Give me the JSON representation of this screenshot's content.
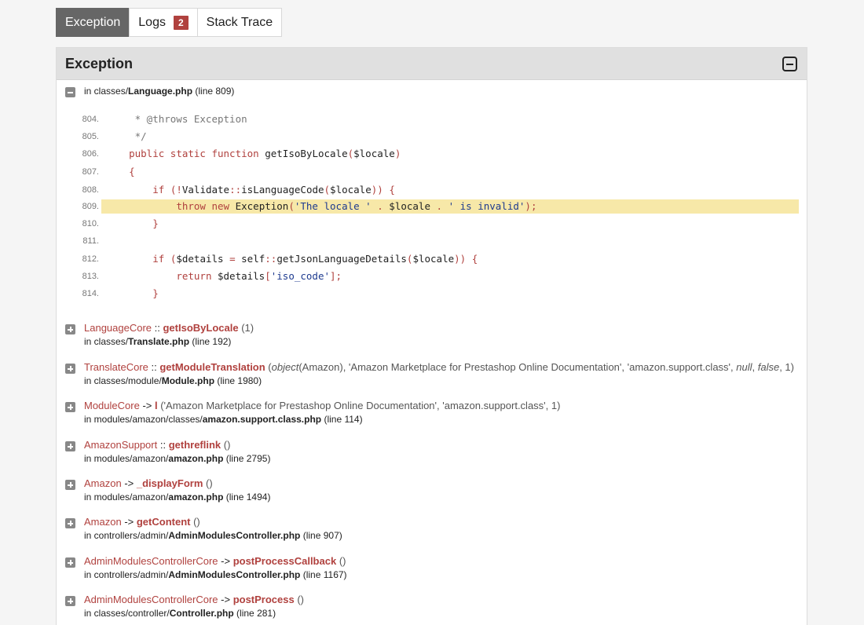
{
  "tabs": [
    {
      "label": "Exception",
      "active": true
    },
    {
      "label": "Logs",
      "badge": "2"
    },
    {
      "label": "Stack Trace"
    }
  ],
  "panel": {
    "title": "Exception",
    "location": {
      "prefix": "in classes/",
      "file": "Language.php",
      "suffix": " (line 809)"
    }
  },
  "code": [
    {
      "num": "804.",
      "text": "     * @throws Exception"
    },
    {
      "num": "805.",
      "text": "     */"
    },
    {
      "num": "806.",
      "text": "    public static function getIsoByLocale($locale)"
    },
    {
      "num": "807.",
      "text": "    {"
    },
    {
      "num": "808.",
      "text": "        if (!Validate::isLanguageCode($locale)) {"
    },
    {
      "num": "809.",
      "text": "            throw new Exception('The locale ' . $locale . ' is invalid');",
      "highlight": true
    },
    {
      "num": "810.",
      "text": "        }"
    },
    {
      "num": "811.",
      "text": ""
    },
    {
      "num": "812.",
      "text": "        if ($details = self::getJsonLanguageDetails($locale)) {"
    },
    {
      "num": "813.",
      "text": "            return $details['iso_code'];"
    },
    {
      "num": "814.",
      "text": "        }"
    }
  ],
  "frames": [
    {
      "cls": "LanguageCore",
      "sep": " :: ",
      "fn": "getIsoByLocale",
      "args": " (1)",
      "loc_prefix": "in classes/",
      "loc_file": "Translate.php",
      "loc_suffix": " (line 192)"
    },
    {
      "cls": "TranslateCore",
      "sep": " :: ",
      "fn": "getModuleTranslation",
      "args_pre": " (",
      "args_obj": "object",
      "args_mid": "(Amazon), 'Amazon Marketplace for Prestashop Online Documentation', 'amazon.support.class', ",
      "args_null": "null",
      "args_sep": ", ",
      "args_false": "false",
      "args_end": ", 1)",
      "loc_prefix": "in classes/module/",
      "loc_file": "Module.php",
      "loc_suffix": " (line 1980)"
    },
    {
      "cls": "ModuleCore",
      "sep": " -> ",
      "fn": "l",
      "args": " ('Amazon Marketplace for Prestashop Online Documentation', 'amazon.support.class', 1)",
      "loc_prefix": "in modules/amazon/classes/",
      "loc_file": "amazon.support.class.php",
      "loc_suffix": " (line 114)"
    },
    {
      "cls": "AmazonSupport",
      "sep": " :: ",
      "fn": "gethreflink",
      "args": " ()",
      "loc_prefix": "in modules/amazon/",
      "loc_file": "amazon.php",
      "loc_suffix": " (line 2795)"
    },
    {
      "cls": "Amazon",
      "sep": " -> ",
      "fn": "_displayForm",
      "args": " ()",
      "loc_prefix": "in modules/amazon/",
      "loc_file": "amazon.php",
      "loc_suffix": " (line 1494)"
    },
    {
      "cls": "Amazon",
      "sep": " -> ",
      "fn": "getContent",
      "args": " ()",
      "loc_prefix": "in controllers/admin/",
      "loc_file": "AdminModulesController.php",
      "loc_suffix": " (line 907)"
    },
    {
      "cls": "AdminModulesControllerCore",
      "sep": " -> ",
      "fn": "postProcessCallback",
      "args": " ()",
      "loc_prefix": "in controllers/admin/",
      "loc_file": "AdminModulesController.php",
      "loc_suffix": " (line 1167)"
    },
    {
      "cls": "AdminModulesControllerCore",
      "sep": " -> ",
      "fn": "postProcess",
      "args": " ()",
      "loc_prefix": "in classes/controller/",
      "loc_file": "Controller.php",
      "loc_suffix": " (line 281)"
    }
  ]
}
